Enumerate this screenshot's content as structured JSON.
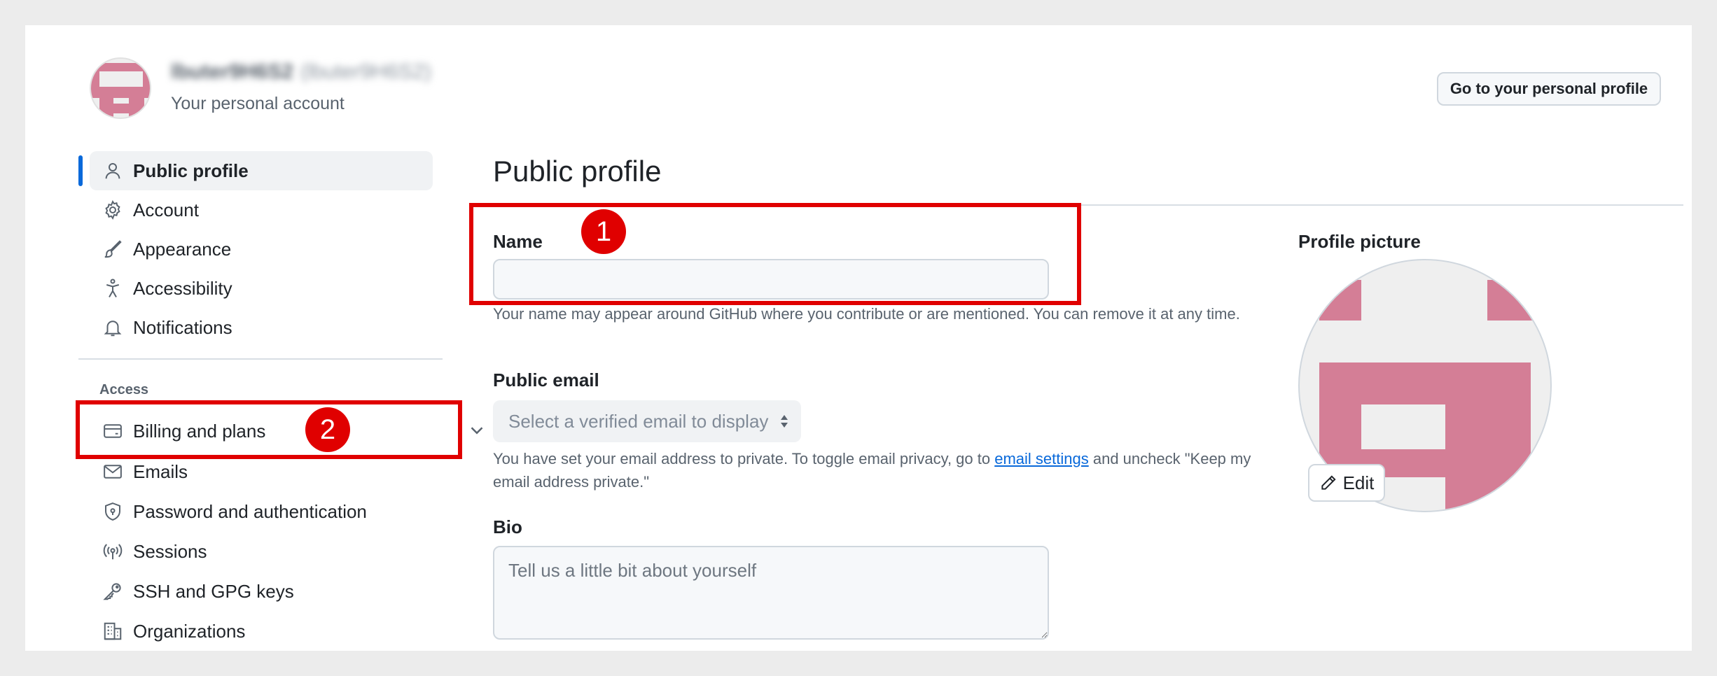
{
  "header": {
    "username": "lbuter9H6S2",
    "username_paren": "(lbuter9H6S2)",
    "account_subtitle": "Your personal account",
    "go_profile_label": "Go to your personal profile"
  },
  "sidebar": {
    "items": [
      {
        "label": "Public profile",
        "icon": "person-icon",
        "active": true
      },
      {
        "label": "Account",
        "icon": "gear-icon"
      },
      {
        "label": "Appearance",
        "icon": "paintbrush-icon"
      },
      {
        "label": "Accessibility",
        "icon": "accessibility-icon"
      },
      {
        "label": "Notifications",
        "icon": "bell-icon"
      }
    ],
    "access_heading": "Access",
    "access_items": [
      {
        "label": "Billing and plans",
        "icon": "credit-card-icon",
        "expandable": true
      },
      {
        "label": "Emails",
        "icon": "mail-icon"
      },
      {
        "label": "Password and authentication",
        "icon": "shield-lock-icon"
      },
      {
        "label": "Sessions",
        "icon": "broadcast-icon"
      },
      {
        "label": "SSH and GPG keys",
        "icon": "key-icon"
      },
      {
        "label": "Organizations",
        "icon": "organization-icon"
      }
    ]
  },
  "main": {
    "title": "Public profile",
    "name": {
      "label": "Name",
      "value": "",
      "help": "Your name may appear around GitHub where you contribute or are mentioned. You can remove it at any time."
    },
    "public_email": {
      "label": "Public email",
      "selected": "Select a verified email to display",
      "help_before": "You have set your email address to private. To toggle email privacy, go to ",
      "help_link": "email settings",
      "help_after": " and uncheck \"Keep my email address private.\""
    },
    "bio": {
      "label": "Bio",
      "placeholder": "Tell us a little bit about yourself"
    },
    "profile_picture": {
      "label": "Profile picture",
      "edit_label": "Edit"
    }
  },
  "annotations": {
    "badge_1": "1",
    "badge_2": "2",
    "color": "#e00000"
  },
  "colors": {
    "accent": "#0969da",
    "avatar_pink": "#d47e96"
  }
}
